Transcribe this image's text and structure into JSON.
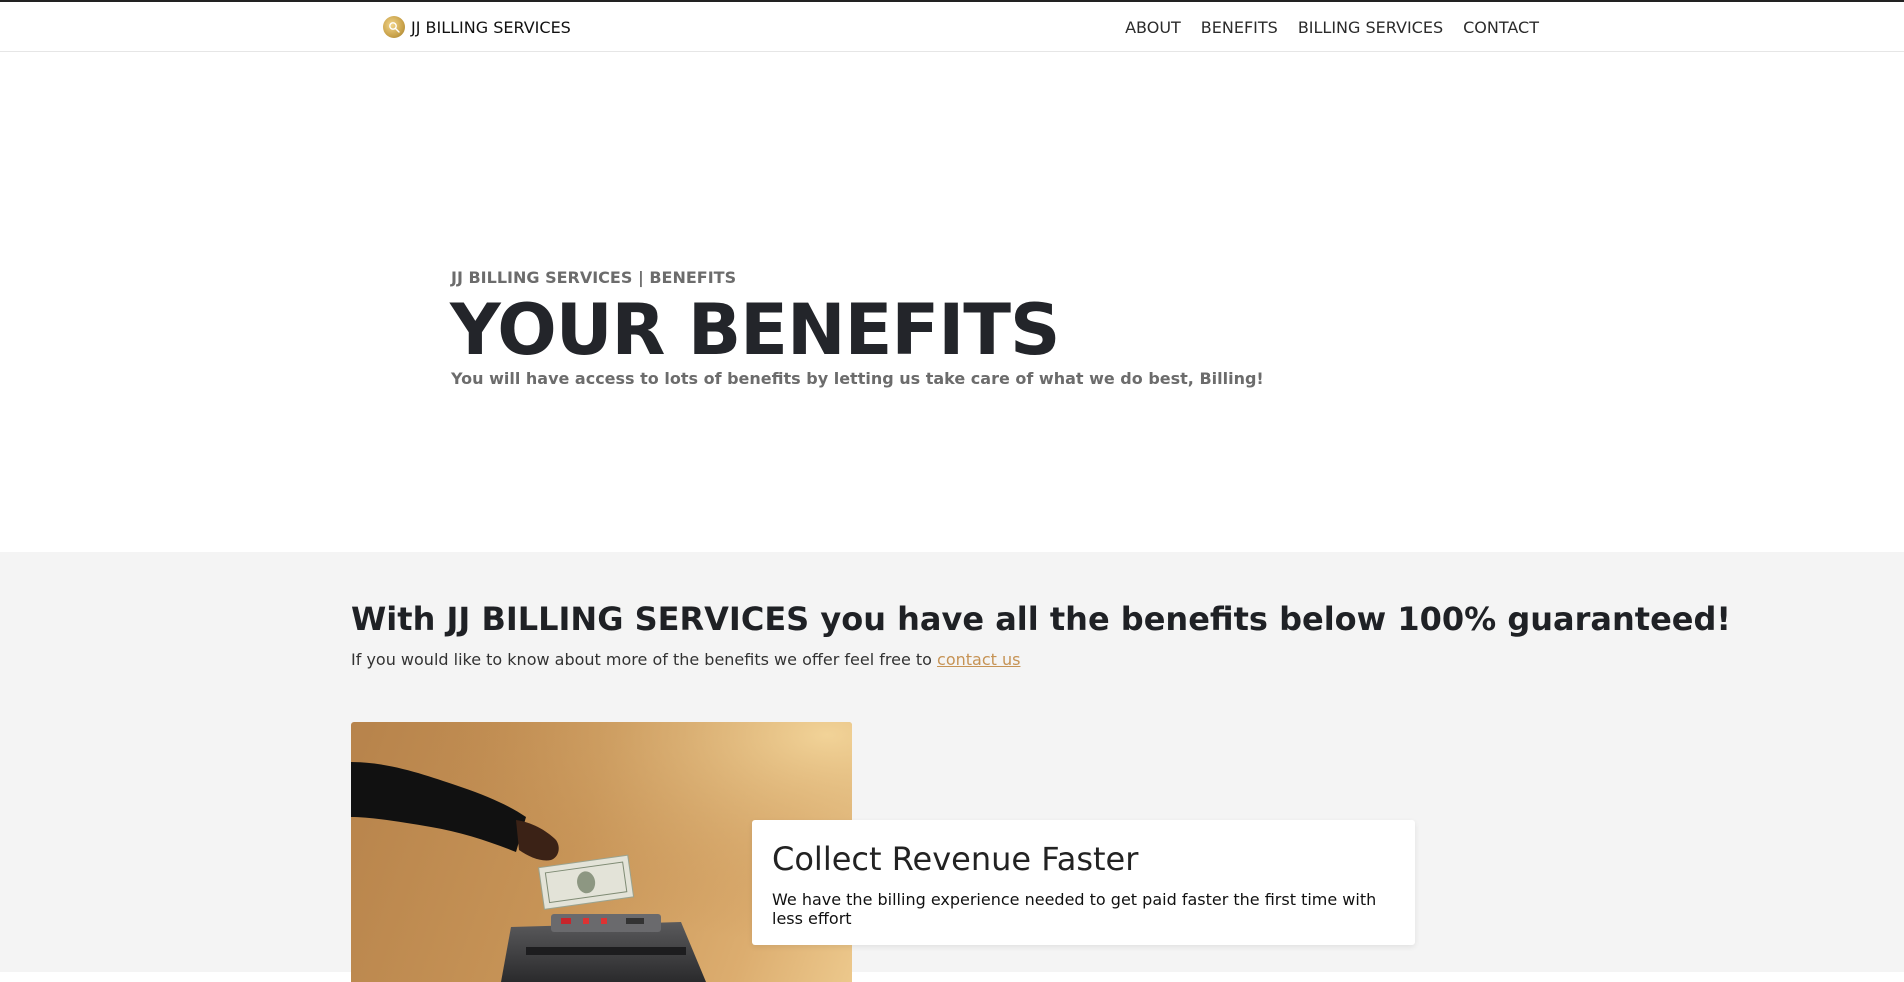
{
  "nav": {
    "brand": "JJ BILLING SERVICES",
    "logo_icon": "jj-billing-logo-icon",
    "links": [
      "ABOUT",
      "BENEFITS",
      "BILLING SERVICES",
      "CONTACT"
    ]
  },
  "hero": {
    "eyebrow": "JJ BILLING SERVICES | BENEFITS",
    "title": "YOUR BENEFITS",
    "subtitle": "You will have access to lots of benefits by letting us take care of what we do best, Billing!"
  },
  "benefits": {
    "heading": "With JJ BILLING SERVICES you have all the benefits below 100% guaranteed!",
    "intro": "If you would like to know about more of the benefits we offer feel free to",
    "intro_link": "contact us",
    "cards": [
      {
        "title": "Collect Revenue Faster",
        "text": "We have the billing experience needed to get paid faster the first time with less effort",
        "image": "hand-inserting-cash-into-money-counter-photo"
      }
    ]
  },
  "colors": {
    "link": "#c69355",
    "section_bg": "#f4f4f4",
    "title": "#23252a",
    "muted": "#6c6c6c"
  }
}
